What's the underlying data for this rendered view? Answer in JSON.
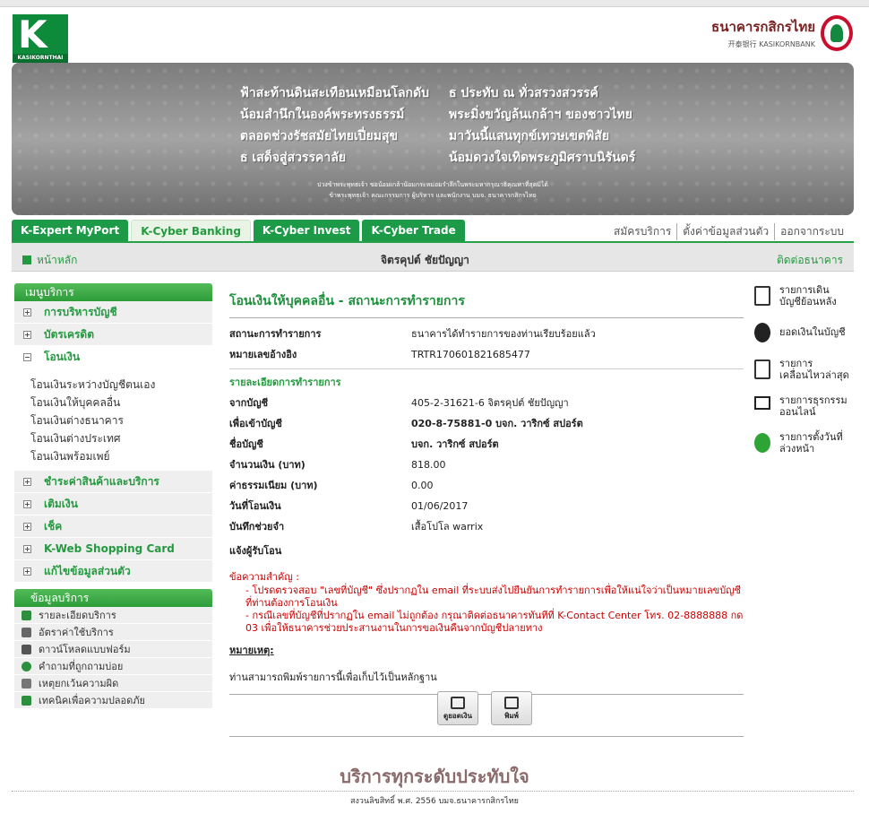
{
  "header": {
    "logo_caption": "KASIKORNTHAI",
    "logo_letter": "K",
    "bank_name_th": "ธนาคารกสิกรไทย",
    "bank_name_en": "开泰银行 KASIKORNBANK"
  },
  "banner": {
    "poem_left": [
      "ฟ้าสะท้านดินสะเทือนเหมือนโลกดับ",
      "น้อมสำนึกในองค์พระทรงธรรม์",
      "ตลอดช่วงรัชสมัยไทยเปี่ยมสุข",
      "ธ เสด็จสู่สวรรคาลัย"
    ],
    "poem_right": [
      "ธ ประทับ ณ ทั่วสรวงสวรรค์",
      "พระมิ่งขวัญล้นเกล้าฯ ของชาวไทย",
      "มาวันนี้แสนทุกข์เทวษเขตพิสัย",
      "น้อมดวงใจเทิดพระภูมิศราบนิรันดร์"
    ],
    "dedication": [
      "ปวงข้าพระพุทธเจ้า ขอน้อมเกล้าน้อมกระหม่อมรำลึกในพระมหากรุณาธิคุณหาที่สุดมิได้",
      "ข้าพระพุทธเจ้า คณะกรรมการ ผู้บริหาร และพนักงาน บมจ. ธนาคารกสิกรไทย"
    ]
  },
  "main_tabs": [
    "K-Expert MyPort",
    "K-Cyber Banking",
    "K-Cyber Invest",
    "K-Cyber Trade"
  ],
  "top_links": [
    "สมัครบริการ",
    "ตั้งค่าข้อมูลส่วนตัว",
    "ออกจากระบบ"
  ],
  "subbar": {
    "home": "หน้าหลัก",
    "user": "จิตรคุปต์ ชัยปัญญา",
    "contact": "ติดต่อธนาคาร"
  },
  "sidebar": {
    "title": "เมนูบริการ",
    "items": [
      "การบริหารบัญชี",
      "บัตรเครดิต",
      "โอนเงิน",
      "ชำระค่าสินค้าและบริการ",
      "เติมเงิน",
      "เช็ค",
      "K-Web Shopping Card",
      "แก้ไขข้อมูลส่วนตัว"
    ],
    "transfer_sub": [
      "โอนเงินระหว่างบัญชีตนเอง",
      "โอนเงินให้บุคคลอื่น",
      "โอนเงินต่างธนาคาร",
      "โอนเงินต่างประเทศ",
      "โอนเงินพร้อมเพย์"
    ],
    "info_title": "ข้อมูลบริการ",
    "info_items": [
      "รายละเอียดบริการ",
      "อัตราค่าใช้บริการ",
      "ดาวน์โหลดแบบฟอร์ม",
      "คำถามที่ถูกถามบ่อย",
      "เหตุยกเว้นความผิด",
      "เทคนิคเพื่อความปลอดภัย"
    ]
  },
  "content": {
    "title": "โอนเงินให้บุคคลอื่น - สถานะการทำรายการ",
    "status_label": "สถานะการทำรายการ",
    "status_value": "ธนาคารได้ทำรายการของท่านเรียบร้อยแล้ว",
    "ref_label": "หมายเลขอ้างอิง",
    "ref_value": "TRTR170601821685477",
    "details_title": "รายละเอียดการทำรายการ",
    "from_label": "จากบัญชี",
    "from_value": "405-2-31621-6 จิตรคุปต์ ชัยปัญญา",
    "to_label": "เพื่อเข้าบัญชี",
    "to_value": "020-8-75881-0 บจก. วาริกซ์ สปอร์ต",
    "name_label": "ชื่อบัญชี",
    "name_value": "บจก. วาริกซ์ สปอร์ต",
    "amount_label": "จำนวนเงิน (บาท)",
    "amount_value": "818.00",
    "fee_label": "ค่าธรรมเนียม (บาท)",
    "fee_value": "0.00",
    "date_label": "วันที่โอนเงิน",
    "date_value": "01/06/2017",
    "memo_label": "บันทึกช่วยจำ",
    "memo_value": "เสื้อโปโล warrix",
    "notify_label": "แจ้งผู้รับโอน",
    "important_title": "ข้อความสำคัญ :",
    "important_1": "- โปรดตรวจสอบ \"เลขที่บัญชี\" ซึ่งปรากฏใน email ที่ระบบส่งไปยืนยันการทำรายการเพื่อให้แน่ใจว่าเป็นหมายเลขบัญชีที่ท่านต้องการโอนเงิน",
    "important_2": "- กรณีเลขที่บัญชีที่ปรากฏใน email ไม่ถูกต้อง กรุณาติดต่อธนาคารทันทีที่ K-Contact Center โทร. 02-8888888 กด 03 เพื่อให้ธนาคารช่วยประสานงานในการขอเงินคืนจากบัญชีปลายทาง",
    "remark_title": "หมายเหตุ:",
    "remark_text": "ท่านสามารถพิมพ์รายการนี้เพื่อเก็บไว้เป็นหลักฐาน",
    "btn_balance": "ดูยอดเงิน",
    "btn_print": "พิมพ์"
  },
  "quick_links": [
    {
      "label": "รายการเดินบัญชีย้อนหลัง",
      "icon": "statement-icon"
    },
    {
      "label": "ยอดเงินในบัญชี",
      "icon": "money-bag-icon"
    },
    {
      "label": "รายการเคลื่อนไหวล่าสุด",
      "icon": "checklist-icon"
    },
    {
      "label": "รายการธุรกรรมออนไลน์",
      "icon": "computer-icon"
    },
    {
      "label": "รายการตั้งวันที่ล่วงหน้า",
      "icon": "clock-icon"
    }
  ],
  "footer": {
    "slogan": "บริการทุกระดับประทับใจ",
    "copyright": "สงวนลิขสิทธิ์ พ.ศ. 2556 บมจ.ธนาคารกสิกรไทย"
  },
  "colors": {
    "brand_green": "#239a3f",
    "alert_red": "#cc0000"
  }
}
